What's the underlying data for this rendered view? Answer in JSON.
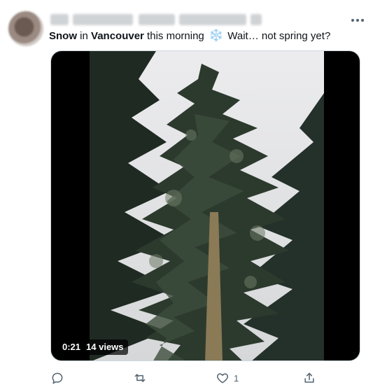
{
  "tweet": {
    "text_parts": {
      "snow": "Snow",
      "in": " in ",
      "city": "Vancouver",
      "rest": " this morning ",
      "emoji": "❄️",
      "tail": " Wait… not spring yet?"
    },
    "video": {
      "time": "0:21",
      "views": "14 views"
    },
    "actions": {
      "like_count": "1"
    }
  },
  "icons": [
    "more-icon",
    "reply-icon",
    "retweet-icon",
    "like-icon",
    "share-icon"
  ]
}
